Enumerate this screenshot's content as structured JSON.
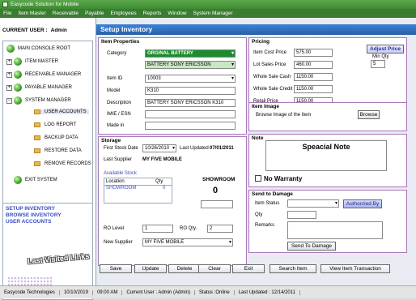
{
  "window": {
    "title": "Easycode Solution for Mobile"
  },
  "menu": [
    "File",
    "Item Master",
    "Receivable",
    "Payable",
    "Employees",
    "Reports",
    "Window",
    "System Manager"
  ],
  "left": {
    "current_user_label": "CURRENT USER :",
    "current_user": "Admin",
    "tree": {
      "root": "MAIN CONSOLE ROOT",
      "item_master": "ITEM MASTER",
      "receivable": "RECEIVABLE MANAGER",
      "payable": "PAYABLE MANAGER",
      "system": "SYSTEM MANAGER",
      "user_accounts": "USER ACCOUNTS",
      "log_report": "LOG REPORT",
      "backup": "BACKUP DATA",
      "restore": "RESTORE DATA",
      "remove": "REMOVE RECORDS",
      "exit": "EXIT SYSTEM"
    },
    "links": [
      "SETUP INVENTORY",
      "BROWSE INVENTORY",
      "USER ACCOUNTS"
    ],
    "last_visited": "Last Visited Links"
  },
  "header": {
    "title": "Setup Inventory"
  },
  "item_properties": {
    "title": "Item Properties",
    "category_label": "Category",
    "category": "ORGINAL BATTERY",
    "subcategory": "BATTERY SONY ERICSSON",
    "item_id_label": "Item ID",
    "item_id": "10003",
    "model_label": "Model",
    "model": "K310",
    "description_label": "Description",
    "description": "BATTERY SONY ERICSSON K310",
    "imie_label": "IMIE / ESN",
    "imie": "",
    "made_in_label": "Made in",
    "made_in": ""
  },
  "pricing": {
    "title": "Pricing",
    "adjust_price": "Adjust Price",
    "min_qty_label": "Min Qty",
    "min_qty": "5",
    "item_cost_label": "Item Cost Price",
    "item_cost": "575.00",
    "lot_sales_label": "Lot Sales Price",
    "lot_sales": "460.00",
    "whole_cash_label": "Whole Sale Cash",
    "whole_cash": "1150.00",
    "whole_credit_label": "Whole Sale Credit",
    "whole_credit": "1150.00",
    "retail_label": "Retail Price",
    "retail": "1150.00"
  },
  "item_image": {
    "title": "Item Image",
    "prompt": "Browse Image of the Item",
    "browse": "Browse"
  },
  "storage": {
    "title": "Storage",
    "first_stock_label": "First Stock Date",
    "first_stock": "10/26/2010",
    "last_updated_label": "Last Updated",
    "last_updated": "07/01/2011",
    "last_supplier_label": "Last Supplier",
    "last_supplier": "MY FIVE MOBILE",
    "available_stock": "Available Stock",
    "col_location": "Location",
    "col_qty": "Qty",
    "stock_location": "SHOWROOM",
    "stock_qty": "0",
    "showroom_label": "SHOWROOM",
    "showroom_qty": "0",
    "ro_level_label": "RO Level",
    "ro_level": "1",
    "ro_qty_label": "RO Qty.",
    "ro_qty": "2",
    "new_supplier_label": "New Supplier",
    "new_supplier": "MY FIVE MOBILE"
  },
  "note": {
    "title": "Note",
    "special_note": "Speacial Note",
    "no_warranty": "No Warranty"
  },
  "damage": {
    "title": "Send to Damage",
    "item_status_label": "Item Status",
    "item_status": "",
    "authorized": "Authorzied By",
    "qty_label": "Qty",
    "remarks_label": "Remarks",
    "send_button": "Send To Damage"
  },
  "actions": {
    "save": "Save",
    "update": "Update",
    "delete": "Delete",
    "clear": "Clear",
    "exit": "Exit",
    "search": "Search Item",
    "view": "View Item Transaction"
  },
  "status": {
    "company": "Easycode Technologies",
    "date": "10/10/2019",
    "time": "09:00 AM",
    "user": "Current User : Admin (Admin)",
    "status": "Status :Online",
    "last_updated": "Last Updated : 12/14/2011"
  },
  "colors": {
    "menu_green": "#3a7d30",
    "header_blue": "#2a5fa8",
    "category_green": "#1c8c2f",
    "link_blue": "#3b4cc8"
  }
}
